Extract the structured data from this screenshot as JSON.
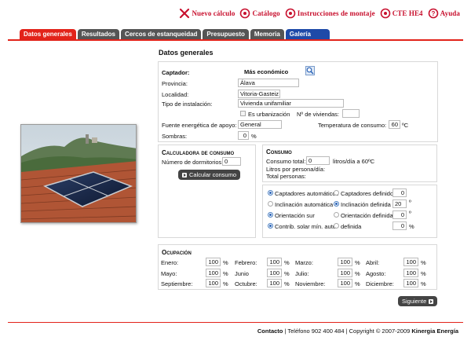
{
  "top_menu": [
    {
      "label": "Nuevo cálculo",
      "icon": "new-calculation-icon"
    },
    {
      "label": "Catálogo",
      "icon": "catalog-icon"
    },
    {
      "label": "Instrucciones de montaje",
      "icon": "instructions-icon"
    },
    {
      "label": "CTE HE4",
      "icon": "cte-icon"
    },
    {
      "label": "Ayuda",
      "icon": "help-icon"
    }
  ],
  "tabs": [
    {
      "label": "Datos generales",
      "state": "active"
    },
    {
      "label": "Resultados"
    },
    {
      "label": "Cercos de estanqueidad"
    },
    {
      "label": "Presupuesto"
    },
    {
      "label": "Memoria"
    },
    {
      "label": "Galería"
    }
  ],
  "colors": {
    "accent": "#e2231a",
    "tab_gray": "#555555",
    "tab_blue": "#1e4aa8",
    "menu_red": "#c8102e"
  },
  "page_title": "Datos generales",
  "general": {
    "captador_label": "Captador:",
    "captador_value": "Más económico",
    "provincia_label": "Provincia:",
    "provincia_value": "Álava",
    "localidad_label": "Localidad:",
    "localidad_value": "Vitoria-Gasteiz",
    "tipo_label": "Tipo de instalación:",
    "tipo_value": "Vivienda unifamiliar",
    "urbanizacion_label": "Es urbanización",
    "viviendas_label": "Nº de viviendas:",
    "viviendas_value": "",
    "fuente_label": "Fuente energética de apoyo:",
    "fuente_value": "General",
    "temp_label": "Temperatura de consumo:",
    "temp_value": "60",
    "temp_unit": "ºC",
    "sombras_label": "Sombras:",
    "sombras_value": "0",
    "sombras_unit": "%"
  },
  "calculadora": {
    "title": "Calculadora de consumo",
    "dormitorios_label": "Número de dormitorios:",
    "dormitorios_value": "0",
    "button": "Calcular consumo"
  },
  "consumo": {
    "title": "Consumo",
    "total_label": "Consumo total:",
    "total_value": "0",
    "total_unit": "litros/día a 60ºC",
    "persona_label": "Litros por persona/día:",
    "personas_label": "Total personas:"
  },
  "options": {
    "captadores_auto": "Captadores automáticos",
    "captadores_def": "Captadores definidos",
    "captadores_value": "0",
    "incl_auto": "Inclinación automática",
    "incl_def": "Inclinación definida",
    "incl_value": "20",
    "incl_unit": "º",
    "orient_sur": "Orientación sur",
    "orient_def": "Orientación definida",
    "orient_value": "0",
    "orient_unit": "º",
    "contrib_auto": "Contrib. solar mín. auto",
    "contrib_def": "definida",
    "contrib_value": "0",
    "contrib_unit": "%"
  },
  "ocupacion": {
    "title": "Ocupación",
    "unit": "%",
    "months": [
      {
        "name": "Enero:",
        "value": "100"
      },
      {
        "name": "Febrero:",
        "value": "100"
      },
      {
        "name": "Marzo:",
        "value": "100"
      },
      {
        "name": "Abril:",
        "value": "100"
      },
      {
        "name": "Mayo:",
        "value": "100"
      },
      {
        "name": "Junio",
        "value": "100"
      },
      {
        "name": "Julio:",
        "value": "100"
      },
      {
        "name": "Agosto:",
        "value": "100"
      },
      {
        "name": "Septiembre:",
        "value": "100"
      },
      {
        "name": "Octubre:",
        "value": "100"
      },
      {
        "name": "Noviembre:",
        "value": "100"
      },
      {
        "name": "Diciembre:",
        "value": "100"
      }
    ]
  },
  "next_button": "Siguiente",
  "footer": {
    "contact": "Contacto",
    "phone": " | Teléfono 902 400 484 | Copyright © 2007-2009 ",
    "company": "Kinergia Energía"
  }
}
